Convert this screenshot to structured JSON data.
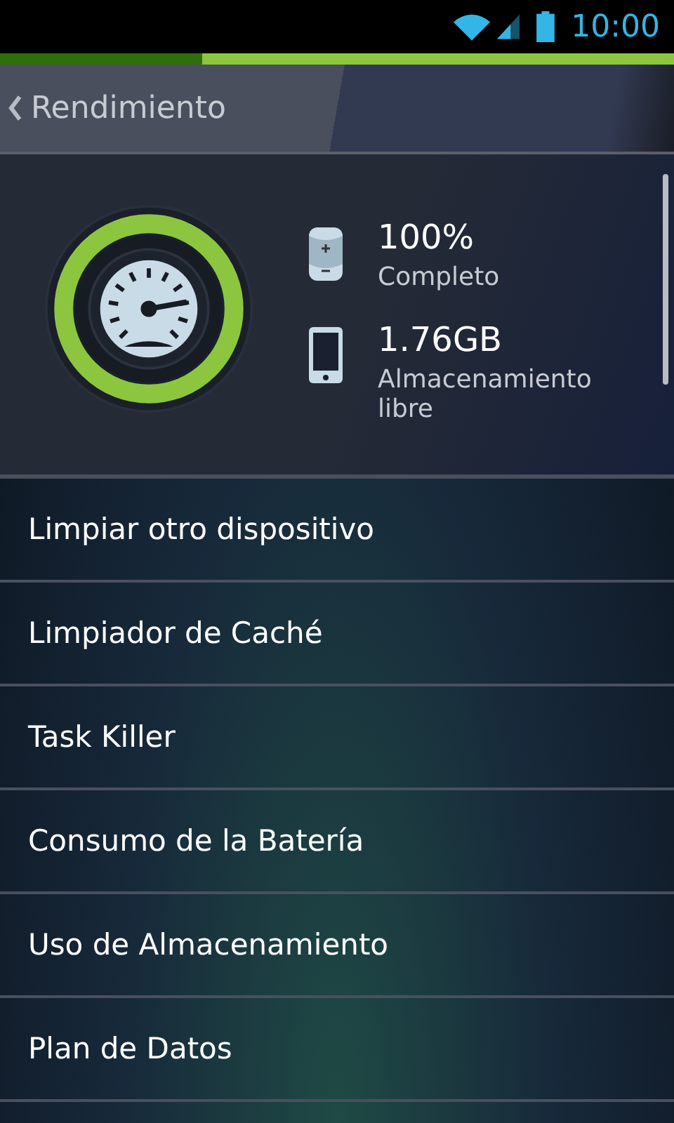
{
  "status_bar": {
    "time": "10:00"
  },
  "header": {
    "title": "Rendimiento"
  },
  "stats": [
    {
      "kind": "battery",
      "value": "100%",
      "label": "Completo"
    },
    {
      "kind": "storage",
      "value": "1.76GB",
      "label": "Almacenamiento libre"
    }
  ],
  "menu": [
    {
      "label": "Limpiar otro dispositivo"
    },
    {
      "label": "Limpiador de Caché"
    },
    {
      "label": "Task Killer"
    },
    {
      "label": "Consumo de la Batería"
    },
    {
      "label": "Uso de Almacenamiento"
    },
    {
      "label": "Plan de Datos"
    }
  ]
}
